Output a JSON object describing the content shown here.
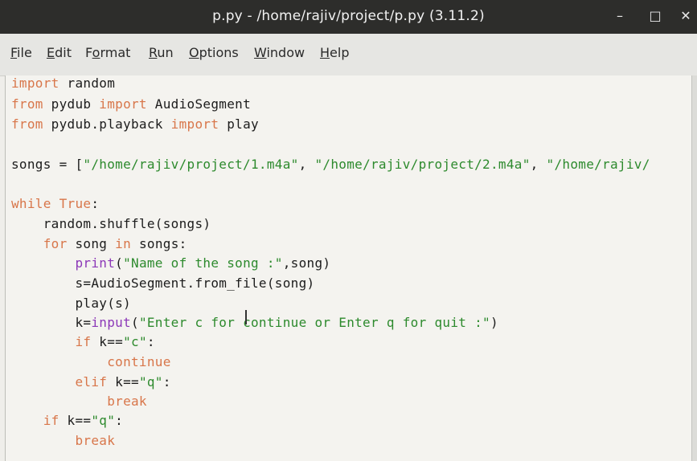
{
  "window": {
    "title": "p.py - /home/rajiv/project/p.py (3.11.2)",
    "controls": {
      "minimize": "–",
      "maximize": "□",
      "close": "✕"
    }
  },
  "menubar": {
    "items": [
      {
        "pre": "",
        "ul": "F",
        "post": "ile"
      },
      {
        "pre": "",
        "ul": "E",
        "post": "dit"
      },
      {
        "pre": "F",
        "ul": "o",
        "post": "rmat"
      },
      {
        "pre": "",
        "ul": "R",
        "post": "un"
      },
      {
        "pre": "",
        "ul": "O",
        "post": "ptions"
      },
      {
        "pre": "",
        "ul": "W",
        "post": "indow"
      },
      {
        "pre": "",
        "ul": "H",
        "post": "elp"
      }
    ]
  },
  "code": {
    "l1": {
      "kw": "import",
      "rest": " random"
    },
    "l2": {
      "kw1": "from",
      "mid": " pydub ",
      "kw2": "import",
      "rest": " AudioSegment"
    },
    "l3": {
      "kw1": "from",
      "mid": " pydub.playback ",
      "kw2": "import",
      "rest": " play"
    },
    "l5": {
      "pre": "songs = [",
      "s1": "\"/home/rajiv/project/1.m4a\"",
      "sep1": ", ",
      "s2": "\"/home/rajiv/project/2.m4a\"",
      "sep2": ", ",
      "s3": "\"/home/rajiv/"
    },
    "l7": {
      "kw": "while True",
      "rest": ":"
    },
    "l8": {
      "text": "    random.shuffle(songs)"
    },
    "l9": {
      "indent": "    ",
      "kw1": "for",
      "mid": " song ",
      "kw2": "in",
      "rest": " songs:"
    },
    "l10": {
      "indent": "        ",
      "bi": "print",
      "open": "(",
      "str": "\"Name of the song :\"",
      "rest": ",song)"
    },
    "l11": {
      "text": "        s=AudioSegment.from_file(song)"
    },
    "l12": {
      "text": "        play(s)"
    },
    "l13": {
      "indent": "        k=",
      "bi": "input",
      "open": "(",
      "str": "\"Enter c for continue or Enter q for quit :\"",
      "rest": ")"
    },
    "l14": {
      "indent": "        ",
      "kw": "if",
      "mid": " k==",
      "str": "\"c\"",
      "rest": ":"
    },
    "l15": {
      "indent": "            ",
      "kw": "continue"
    },
    "l16": {
      "indent": "        ",
      "kw": "elif",
      "mid": " k==",
      "str": "\"q\"",
      "rest": ":"
    },
    "l17": {
      "indent": "            ",
      "kw": "break"
    },
    "l18": {
      "indent": "    ",
      "kw": "if",
      "mid": " k==",
      "str": "\"q\"",
      "rest": ":"
    },
    "l19": {
      "indent": "        ",
      "kw": "break"
    }
  }
}
